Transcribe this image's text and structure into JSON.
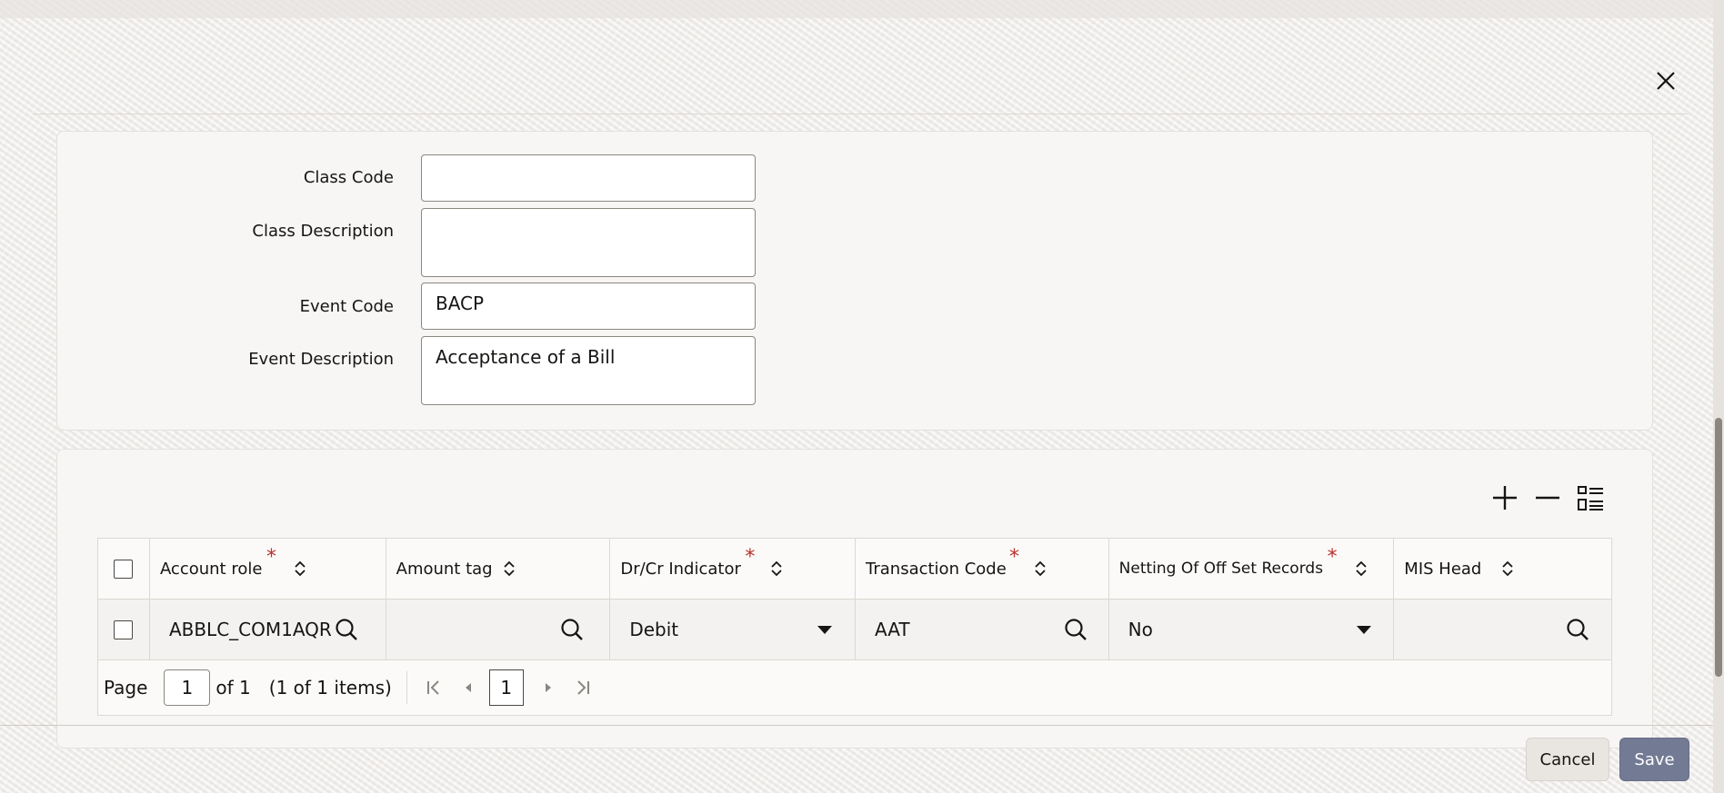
{
  "form": {
    "class_code_label": "Class Code",
    "class_code_value": "",
    "class_description_label": "Class Description",
    "class_description_value": "",
    "event_code_label": "Event Code",
    "event_code_value": "BACP",
    "event_description_label": "Event Description",
    "event_description_value": "Acceptance of a Bill"
  },
  "toolbar": {
    "add_icon": "plus-icon",
    "delete_icon": "minus-icon",
    "view_icon": "list-detail-icon"
  },
  "table": {
    "headers": {
      "account_role": "Account role",
      "amount_tag": "Amount tag",
      "dr_cr_indicator": "Dr/Cr Indicator",
      "transaction_code": "Transaction Code",
      "netting": "Netting Of Off Set Records",
      "mis_head": "MIS Head"
    },
    "required_marker": "*",
    "rows": [
      {
        "account_role": "ABBLC_COM1AQR",
        "amount_tag": "",
        "dr_cr_indicator": "Debit",
        "transaction_code": "AAT",
        "netting": "No",
        "mis_head": ""
      }
    ]
  },
  "pager": {
    "page_label": "Page",
    "page_value": "1",
    "of_label": "of 1",
    "items_label": "(1 of 1 items)",
    "current_page": "1"
  },
  "footer": {
    "cancel_label": "Cancel",
    "save_label": "Save"
  },
  "colors": {
    "required": "#b8312f",
    "save_button": "#737b94"
  }
}
